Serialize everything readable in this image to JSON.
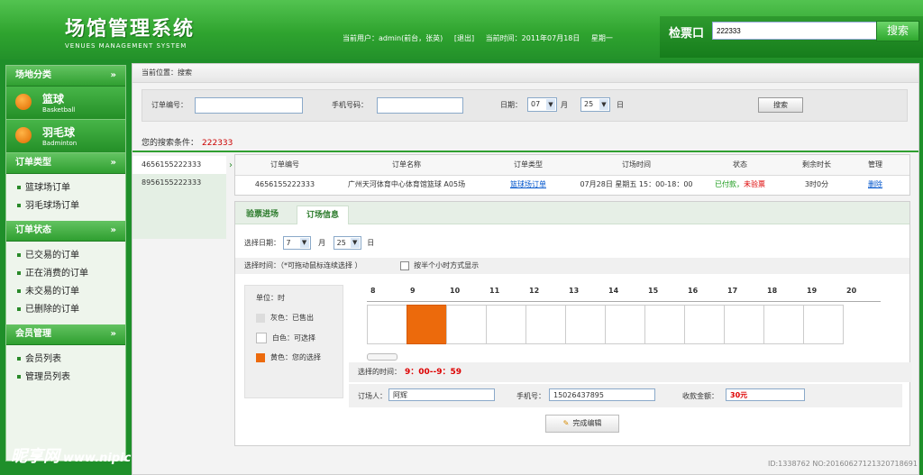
{
  "header": {
    "title_cn": "场馆管理系统",
    "title_en": "VENUES MANAGEMENT SYSTEM",
    "current_user": "当前用户：admin(前台，张英)",
    "logout": "[退出]",
    "current_time": "当前时间：2011年07月18日",
    "weekday": "星期一",
    "ticket_label": "检票口",
    "ticket_value": "222333",
    "ticket_button": "搜索"
  },
  "sidebar": {
    "venue_section": "场地分类",
    "venues": [
      {
        "name": "篮球",
        "en": "Basketball"
      },
      {
        "name": "羽毛球",
        "en": "Badminton"
      }
    ],
    "order_type_section": "订单类型",
    "order_types": [
      "篮球场订单",
      "羽毛球场订单"
    ],
    "order_status_section": "订单状态",
    "order_statuses": [
      "已交易的订单",
      "正在消费的订单",
      "未交易的订单",
      "已删除的订单"
    ],
    "member_section": "会员管理",
    "members": [
      "会员列表",
      "管理员列表"
    ]
  },
  "watermark": {
    "brand": "昵享网",
    "url": "www.nipic.com",
    "id": "ID:1338762 NO:20160627121320718691"
  },
  "main": {
    "breadcrumb": "当前位置：搜索",
    "search": {
      "order_label": "订单编号：",
      "phone_label": "手机号码：",
      "date_label": "日期：",
      "month_value": "07",
      "month_unit": "月",
      "day_value": "25",
      "day_unit": "日",
      "button": "搜索"
    },
    "condition_label": "您的搜索条件：",
    "condition_value": "222333",
    "order_list": [
      "4656155222333",
      "8956155222333"
    ],
    "table": {
      "headers": [
        "订单编号",
        "订单名称",
        "订单类型",
        "订场时间",
        "状态",
        "剩余时长",
        "管理"
      ],
      "row": {
        "order_no": "4656155222333",
        "name": "广州天河体育中心体育馆篮球 A05场",
        "type": "篮球场订单",
        "time": "07月28日 星期五 15：00-18：00",
        "status_paid": "已付款，",
        "status_unchecked": "未验票",
        "remain": "3时0分",
        "action": "删除"
      }
    },
    "detail": {
      "tabs": [
        "验票进场",
        "订场信息"
      ],
      "select_date_label": "选择日期：",
      "month_value": "7",
      "month_unit": "月",
      "day_value": "25",
      "day_unit": "日",
      "select_time_label": "选择时间：（*可拖动鼠标连续选择 ）",
      "half_hour_label": "按半个小时方式显示",
      "unit_label": "单位：时",
      "legend": [
        {
          "label": "灰色：已售出",
          "color": "#dcdcdc"
        },
        {
          "label": "白色：可选择",
          "color": "#ffffff"
        },
        {
          "label": "黄色：您的选择",
          "color": "#ec6a0c"
        }
      ],
      "hours": [
        "8",
        "9",
        "10",
        "11",
        "12",
        "13",
        "14",
        "15",
        "16",
        "17",
        "18",
        "19",
        "20"
      ],
      "selected_hour_index": 1,
      "selected_time_label": "选择的时间：",
      "selected_time_value": "9：00--9：59",
      "booker_label": "订场人：",
      "booker_value": "阿辉",
      "phone_label": "手机号：",
      "phone_value": "15026437895",
      "amount_label": "收款金额：",
      "amount_value": "30元",
      "finish_button": "完成编辑"
    }
  }
}
